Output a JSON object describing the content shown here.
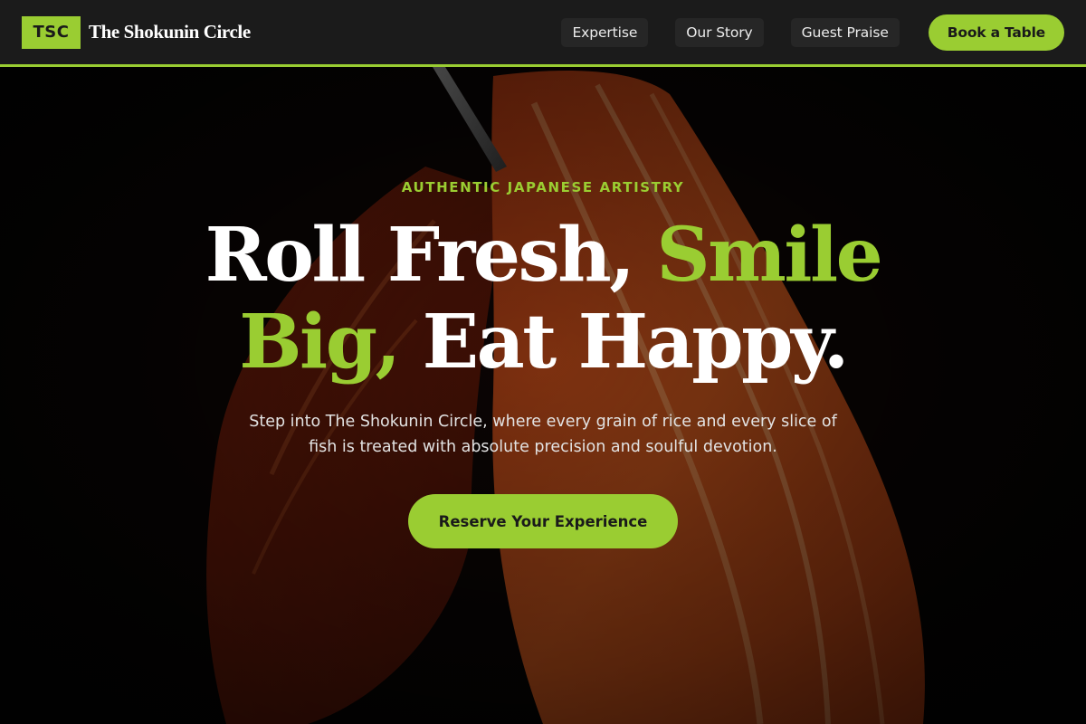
{
  "header": {
    "logo_text": "TSC",
    "brand_name": "The Shokunin Circle",
    "nav": [
      {
        "label": "Expertise"
      },
      {
        "label": "Our Story"
      },
      {
        "label": "Guest Praise"
      }
    ],
    "book_button": "Book a Table"
  },
  "hero": {
    "eyebrow": "AUTHENTIC JAPANESE ARTISTRY",
    "headline": {
      "part1": "Roll Fresh, ",
      "part2": "Smile",
      "part3": "Big,",
      "part4": " Eat Happy."
    },
    "subtext": "Step into The Shokunin Circle, where every grain of rice and every slice of fish is treated with absolute precision and soulful devotion.",
    "cta": "Reserve Your Experience",
    "background_image": "salmon-sashimi-photo"
  },
  "colors": {
    "accent": "#9acd32",
    "nav_bg": "#1b1b1b",
    "hero_bg": "#050505"
  }
}
